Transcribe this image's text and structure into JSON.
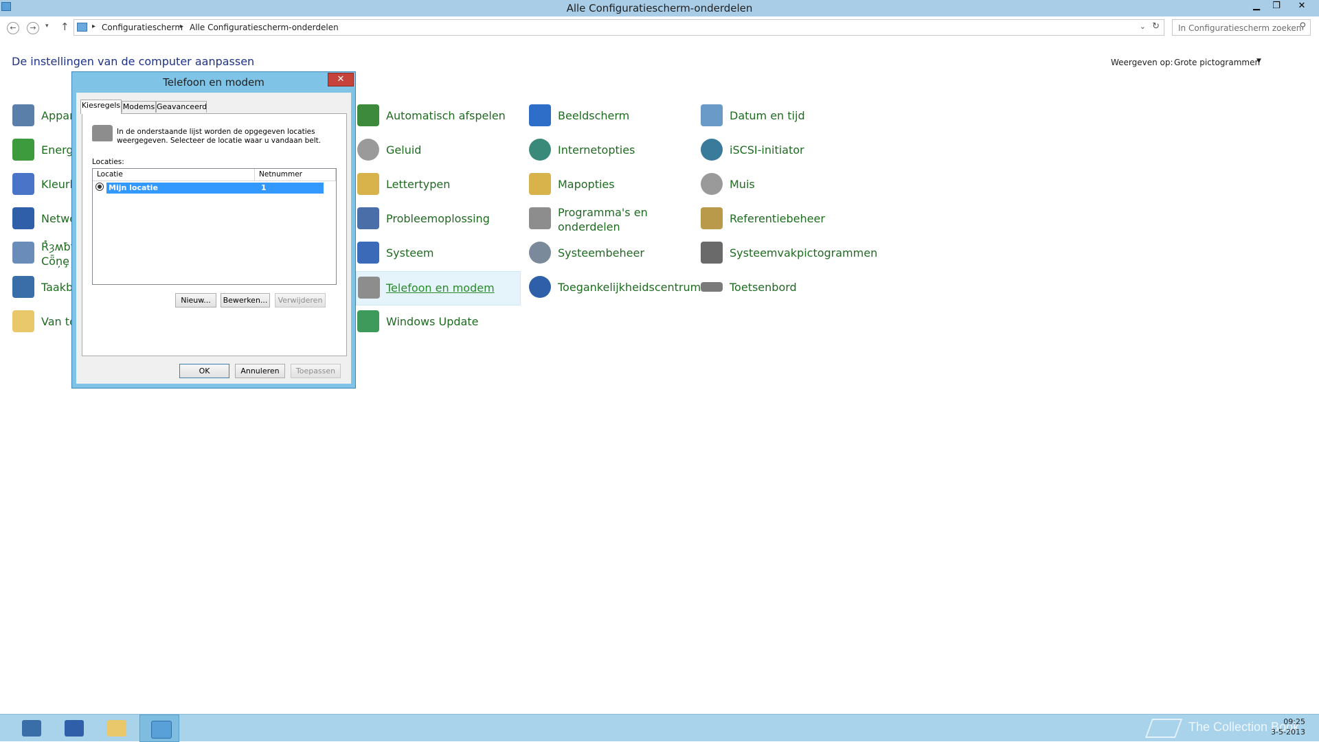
{
  "window": {
    "title": "Alle Configuratiescherm-onderdelen",
    "minimize": "▁",
    "maximize": "❐",
    "close": "✕"
  },
  "nav": {
    "back_icon": "arrow-left-icon",
    "back": "←",
    "forward": "→",
    "history": "▾",
    "up": "↑",
    "breadcrumb": [
      "Configuratiescherm",
      "Alle Configuratiescherm-onderdelen"
    ],
    "breadcrumb_sep": "▸",
    "dropdown": "⌄",
    "refresh": "↻",
    "search_placeholder": "In Configuratiescherm zoeken",
    "search_icon": "⚲"
  },
  "header": {
    "heading": "De instellingen van de computer aanpassen",
    "view_label": "Weergeven op:",
    "view_value": "Grote pictogrammen",
    "view_arrow": "▼"
  },
  "items": {
    "col0": [
      {
        "label": "Appar",
        "icon": "devices-icon",
        "color": "#5a7fa8"
      },
      {
        "label": "Energi",
        "icon": "power-options-icon",
        "color": "#3d9a3d"
      },
      {
        "label": "Kleurb",
        "icon": "color-management-icon",
        "color": "#4a74c8"
      },
      {
        "label": "Netwe",
        "icon": "network-icon",
        "color": "#2f5fa8"
      },
      {
        "label": "Ŕ͑ȝʍƀʈ Cȫņȩ",
        "icon": "region-icon",
        "color": "#6a8cb8"
      },
      {
        "label": "Taakb",
        "icon": "taskbar-icon",
        "color": "#3a6ea8"
      },
      {
        "label": "Van te",
        "icon": "speech-icon",
        "color": "#e8c86a"
      }
    ],
    "col1": [
      {
        "label": "Automatisch afspelen",
        "icon": "autoplay-icon",
        "color": "#3d8a3d"
      },
      {
        "label": "Geluid",
        "icon": "sound-icon",
        "color": "#9a9a9a"
      },
      {
        "label": "Lettertypen",
        "icon": "fonts-icon",
        "color": "#d8b24a"
      },
      {
        "label": "Probleemoplossing",
        "icon": "troubleshooting-icon",
        "color": "#4a6ea8"
      },
      {
        "label": "Systeem",
        "icon": "system-icon",
        "color": "#3a6ab8"
      },
      {
        "label": "Telefoon en modem",
        "icon": "phone-modem-icon",
        "color": "#8d8d8d"
      },
      {
        "label": "Windows Update",
        "icon": "windows-update-icon",
        "color": "#3d9a5a"
      }
    ],
    "col2": [
      {
        "label": "Beeldscherm",
        "icon": "display-icon",
        "color": "#2f6ec8"
      },
      {
        "label": "Internetopties",
        "icon": "internet-options-icon",
        "color": "#3a8a7a"
      },
      {
        "label": "Mapopties",
        "icon": "folder-options-icon",
        "color": "#d8b24a"
      },
      {
        "label": "Programma's en onderdelen",
        "icon": "programs-icon",
        "color": "#8d8d8d"
      },
      {
        "label": "Systeembeheer",
        "icon": "admin-tools-icon",
        "color": "#7a8a9a"
      },
      {
        "label": "Toegankelijkheidscentrum",
        "icon": "ease-of-access-icon",
        "color": "#2f5fa8"
      }
    ],
    "col3": [
      {
        "label": "Datum en tijd",
        "icon": "date-time-icon",
        "color": "#6a9ac8"
      },
      {
        "label": "iSCSI-initiator",
        "icon": "iscsi-icon",
        "color": "#3a7a9a"
      },
      {
        "label": "Muis",
        "icon": "mouse-icon",
        "color": "#9a9a9a"
      },
      {
        "label": "Referentiebeheer",
        "icon": "credential-manager-icon",
        "color": "#b89a4a"
      },
      {
        "label": "Systeemvakpictogrammen",
        "icon": "notification-icons-icon",
        "color": "#6a6a6a"
      },
      {
        "label": "Toetsenbord",
        "icon": "keyboard-icon",
        "color": "#7a7a7a"
      }
    ]
  },
  "dialog": {
    "title": "Telefoon en modem",
    "close": "✕",
    "tabs": [
      "Kiesregels",
      "Modems",
      "Geavanceerd"
    ],
    "description": "In de onderstaande lijst worden de opgegeven locaties weergegeven. Selecteer de locatie waar u vandaan belt.",
    "list_label": "Locaties:",
    "columns": [
      "Locatie",
      "Netnummer"
    ],
    "rows": [
      {
        "location": "Mijn locatie",
        "area_code": "1"
      }
    ],
    "buttons": {
      "new": "Nieuw...",
      "edit": "Bewerken...",
      "delete": "Verwijderen"
    },
    "footer": {
      "ok": "OK",
      "cancel": "Annuleren",
      "apply": "Toepassen"
    }
  },
  "taskbar": {
    "clock_time": "09:25",
    "clock_date": "3-5-2013",
    "watermark": "The Collection Book",
    "accent": "#a9d3ea"
  }
}
